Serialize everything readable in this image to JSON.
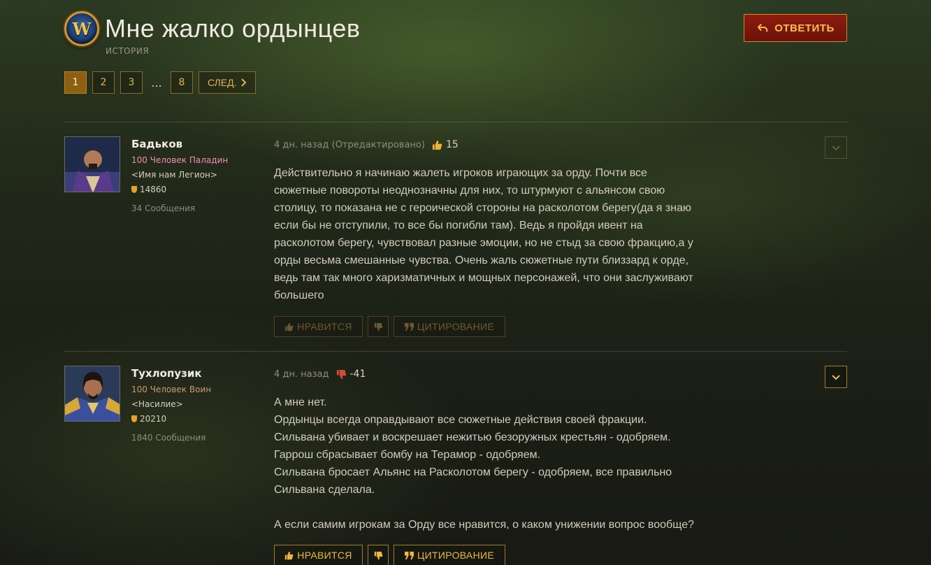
{
  "header": {
    "logo_text": "W",
    "title": "Мне жалко ордынцев",
    "category": "ИСТОРИЯ",
    "reply_label": "ОТВЕТИТЬ"
  },
  "pagination": {
    "pages": [
      "1",
      "2",
      "3",
      "8"
    ],
    "ellipsis": "...",
    "next_label": "СЛЕД.",
    "current": "1"
  },
  "posts": [
    {
      "author": "Бадьков",
      "class_line": "100 Человек Паладин",
      "class_color": "#f58cba",
      "guild": "<Имя нам Легион>",
      "achievements": "14860",
      "post_count": "34 Сообщения",
      "time": "4 дн. назад (Отредактировано)",
      "vote_icon": "thumbs-up-icon",
      "vote_count": "15",
      "lines": [
        "Действительно я начинаю жалеть игроков играющих за орду. Почти все",
        "сюжетные повороты неоднозначны для них, то штурмуют с альянсом свою",
        "столицу, то показана не с героической стороны на расколотом берегу(да я знаю",
        "если бы не отступили, то все бы погибли там). Ведь я пройдя ивент на",
        "расколотом берегу, чувствовал разные эмоции, но не стыд за свою фракцию,а у",
        "орды весьма смешанные чувства. Очень жаль сюжетные пути близзард к орде,",
        "ведь там так много харизматичных и мощных персонажей, что они заслуживают",
        "большего"
      ],
      "like_label": "НРАВИТСЯ",
      "quote_label": "ЦИТИРОВАНИЕ"
    },
    {
      "author": "Тухлопузик",
      "class_line": "100 Человек Воин",
      "class_color": "#c79c6e",
      "guild": "<Насилие>",
      "achievements": "20210",
      "post_count": "1840 Сообщения",
      "time": "4 дн. назад",
      "vote_icon": "thumbs-down-icon",
      "vote_count": "-41",
      "lines": [
        "А мне нет.",
        "Ордынцы всегда оправдывают все сюжетные действия своей фракции.",
        "Сильвана убивает и воскрешает нежитью безоружных крестьян - одобряем.",
        "Гаррош сбрасывает бомбу на Терамор - одобряем.",
        "Сильвана бросает Альянс на Расколотом берегу - одобряем, все правильно",
        "Сильвана сделала.",
        "",
        "А если самим игрокам за Орду все нравится, о каком унижении вопрос вообще?"
      ],
      "like_label": "НРАВИТСЯ",
      "quote_label": "ЦИТИРОВАНИЕ"
    }
  ],
  "colors": {
    "accent": "#e6b24a",
    "reply_bg": "#8e1c10",
    "downvote": "#d44a3a"
  }
}
